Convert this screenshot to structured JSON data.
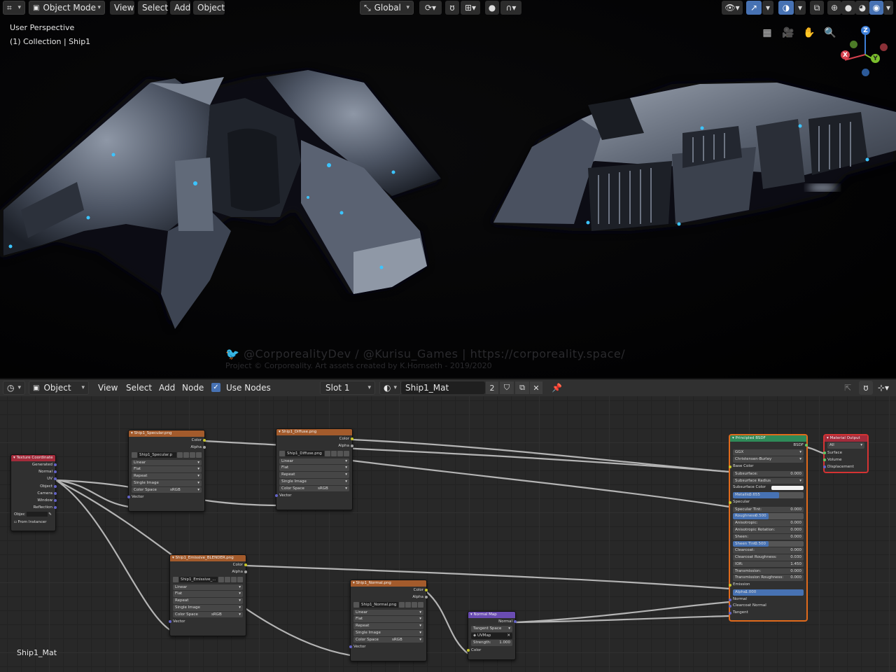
{
  "viewport": {
    "mode": "Object Mode",
    "menus": [
      "View",
      "Select",
      "Add",
      "Object"
    ],
    "transform_orientation": "Global",
    "overlay_title": "User Perspective",
    "overlay_collection": "(1) Collection | Ship1",
    "gizmo_axes": {
      "z": "Z",
      "y": "Y",
      "x": "X"
    },
    "watermark_line1": "🐦 @CorporealityDev / @Kurisu_Games  |  https://corporeality.space/",
    "watermark_line2": "Project © Corporeality. Art assets created by K.Hornseth - 2019/2020",
    "accent_color": "#4772b3",
    "icons": [
      "editor-type-icon",
      "object-mode-icon",
      "transform-orientation-icon",
      "pivot-icon",
      "snap-icon",
      "proportional-icon",
      "visibility-icon",
      "gizmo-icon",
      "overlay-icon",
      "xray-icon",
      "shading-wire-icon",
      "shading-solid-icon",
      "shading-material-icon",
      "shading-rendered-icon",
      "grid-icon",
      "camera-icon",
      "hand-icon",
      "zoom-icon"
    ]
  },
  "node_editor": {
    "object_type": "Object",
    "menus": [
      "View",
      "Select",
      "Add",
      "Node"
    ],
    "use_nodes_label": "Use Nodes",
    "use_nodes_checked": true,
    "slot": "Slot 1",
    "material_name": "Ship1_Mat",
    "user_count": "2",
    "footer_label": "Ship1_Mat"
  },
  "nodes": {
    "texcoord": {
      "title": "Texture Coordinate",
      "outputs": [
        "Generated",
        "Normal",
        "UV",
        "Object",
        "Camera",
        "Window",
        "Reflection"
      ],
      "object_label": "Objec",
      "from_instancer": "From Instancer"
    },
    "specular": {
      "title": "Ship1_Specular.png",
      "outputs": [
        "Color",
        "Alpha"
      ],
      "image": "Ship1_Specular.p",
      "interp": "Linear",
      "proj": "Flat",
      "ext": "Repeat",
      "source": "Single Image",
      "cs_label": "Color Space",
      "cs_value": "sRGB",
      "input": "Vector"
    },
    "diffuse": {
      "title": "Ship1_Diffuse.png",
      "outputs": [
        "Color",
        "Alpha"
      ],
      "image": "Ship1_Diffuse.png",
      "interp": "Linear",
      "proj": "Flat",
      "ext": "Repeat",
      "source": "Single Image",
      "cs_label": "Color Space",
      "cs_value": "sRGB",
      "input": "Vector"
    },
    "emissive": {
      "title": "Ship1_Emissive_BLENDER.png",
      "outputs": [
        "Color",
        "Alpha"
      ],
      "image": "Ship1_Emissive_...",
      "interp": "Linear",
      "proj": "Flat",
      "ext": "Repeat",
      "source": "Single Image",
      "cs_label": "Color Space",
      "cs_value": "sRGB",
      "input": "Vector"
    },
    "normaltex": {
      "title": "Ship1_Normal.png",
      "outputs": [
        "Color",
        "Alpha"
      ],
      "image": "Ship1_Normal.png",
      "interp": "Linear",
      "proj": "Flat",
      "ext": "Repeat",
      "source": "Single Image",
      "cs_label": "Color Space",
      "cs_value": "sRGB",
      "input": "Vector"
    },
    "normalmap": {
      "title": "Normal Map",
      "output": "Normal",
      "space": "Tangent Space",
      "uv": "UVMap",
      "strength_label": "Strength:",
      "strength": "1.000",
      "input": "Color"
    },
    "bsdf": {
      "title": "Principled BSDF",
      "output": "BSDF",
      "dist": "GGX",
      "sss": "Christensen-Burley",
      "rows": [
        {
          "k": "input",
          "label": "Base Color"
        },
        {
          "k": "val",
          "label": "Subsurface:",
          "value": "0.000"
        },
        {
          "k": "dd",
          "label": "Subsurface Radius"
        },
        {
          "k": "color",
          "label": "Subsurface Color"
        },
        {
          "k": "bar",
          "label": "Metallic:",
          "value": "0.655",
          "fill": 0.655
        },
        {
          "k": "input",
          "label": "Specular"
        },
        {
          "k": "val",
          "label": "Specular Tint:",
          "value": "0.000"
        },
        {
          "k": "bar",
          "label": "Roughness:",
          "value": "0.500",
          "fill": 0.5
        },
        {
          "k": "val",
          "label": "Anisotropic:",
          "value": "0.000"
        },
        {
          "k": "val",
          "label": "Anisotropic Rotation:",
          "value": "0.000"
        },
        {
          "k": "val",
          "label": "Sheen:",
          "value": "0.000"
        },
        {
          "k": "bar",
          "label": "Sheen Tint:",
          "value": "0.500",
          "fill": 0.5
        },
        {
          "k": "val",
          "label": "Clearcoat:",
          "value": "0.000"
        },
        {
          "k": "val",
          "label": "Clearcoat Roughness:",
          "value": "0.030"
        },
        {
          "k": "val",
          "label": "IOR:",
          "value": "1.450"
        },
        {
          "k": "val",
          "label": "Transmission:",
          "value": "0.000"
        },
        {
          "k": "val",
          "label": "Transmission Roughness:",
          "value": "0.000"
        },
        {
          "k": "input",
          "label": "Emission"
        },
        {
          "k": "bar",
          "label": "Alpha:",
          "value": "1.000",
          "fill": 1.0
        },
        {
          "k": "input",
          "label": "Normal"
        },
        {
          "k": "input",
          "label": "Clearcoat Normal"
        },
        {
          "k": "input",
          "label": "Tangent"
        }
      ]
    },
    "output": {
      "title": "Material Output",
      "target": "All",
      "inputs": [
        "Surface",
        "Volume",
        "Displacement"
      ]
    }
  }
}
